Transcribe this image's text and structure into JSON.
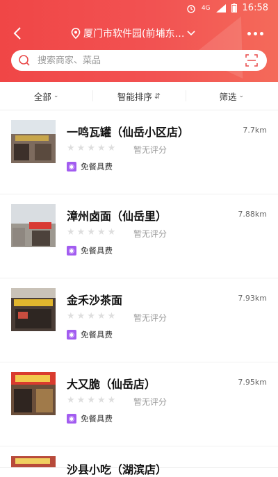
{
  "status": {
    "time": "16:58",
    "network": "4G"
  },
  "header": {
    "location": "厦门市软件园(前埔东…",
    "back_label": "‹"
  },
  "search": {
    "placeholder": "搜索商家、菜品"
  },
  "filters": [
    {
      "label": "全部"
    },
    {
      "label": "智能排序"
    },
    {
      "label": "筛选"
    }
  ],
  "shops": [
    {
      "name": "一鸣瓦罐（仙岳小区店）",
      "distance": "7.7km",
      "rating_text": "暂无评分",
      "tag": "免餐具费"
    },
    {
      "name": "漳州卤面（仙岳里）",
      "distance": "7.88km",
      "rating_text": "暂无评分",
      "tag": "免餐具费"
    },
    {
      "name": "金禾沙茶面",
      "distance": "7.93km",
      "rating_text": "暂无评分",
      "tag": "免餐具费"
    },
    {
      "name": "大又脆（仙岳店）",
      "distance": "7.95km",
      "rating_text": "暂无评分",
      "tag": "免餐具费"
    },
    {
      "name": "沙县小吃（湖滨店）",
      "distance": "",
      "rating_text": "",
      "tag": ""
    }
  ],
  "colors": {
    "brand": "#f04646",
    "badge": "#a25cf0"
  }
}
